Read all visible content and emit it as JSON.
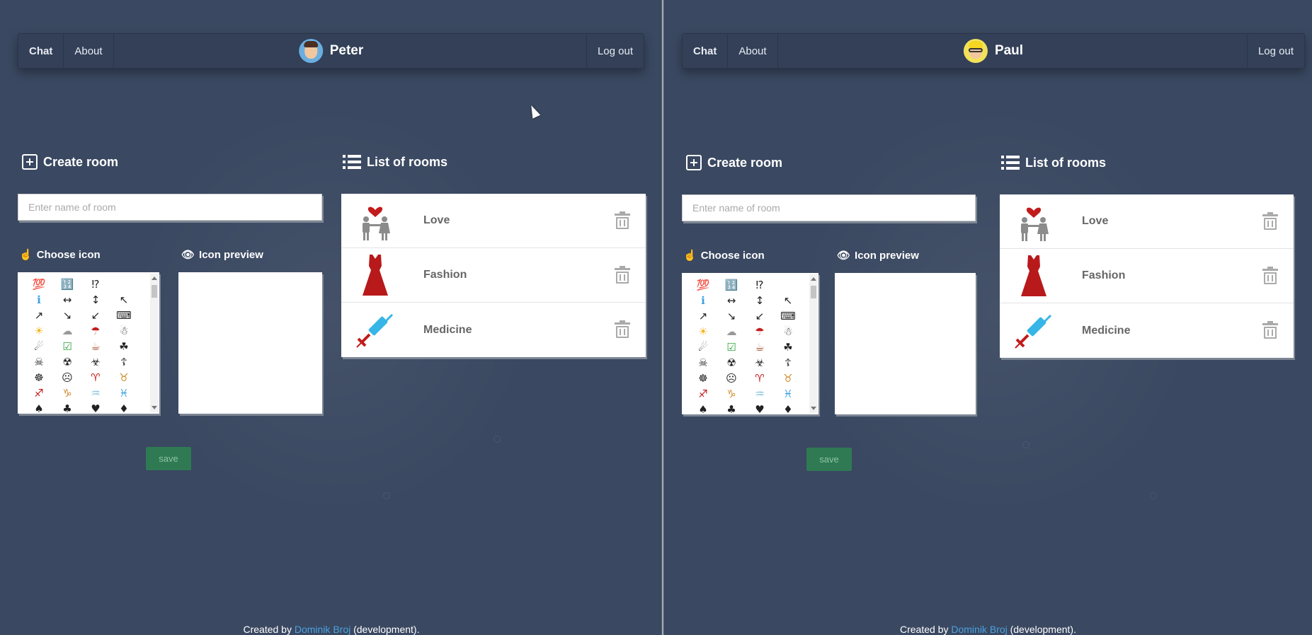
{
  "panes": [
    {
      "nav": {
        "chat": "Chat",
        "about": "About",
        "user": "Peter",
        "logout": "Log out"
      },
      "create_room": {
        "title": "Create room",
        "input_placeholder": "Enter name of room",
        "choose_icon": "Choose icon",
        "icon_preview": "Icon preview",
        "save": "save"
      },
      "list_of_rooms": {
        "title": "List of rooms",
        "rooms": [
          {
            "name": "Love",
            "icon": "couple-heart-icon"
          },
          {
            "name": "Fashion",
            "icon": "dress-icon"
          },
          {
            "name": "Medicine",
            "icon": "syringe-icon"
          }
        ]
      },
      "footer": {
        "prefix": "Created by ",
        "author": "Dominik Broj",
        "suffix": " (development)."
      }
    },
    {
      "nav": {
        "chat": "Chat",
        "about": "About",
        "user": "Paul",
        "logout": "Log out"
      },
      "create_room": {
        "title": "Create room",
        "input_placeholder": "Enter name of room",
        "choose_icon": "Choose icon",
        "icon_preview": "Icon preview",
        "save": "save"
      },
      "list_of_rooms": {
        "title": "List of rooms",
        "rooms": [
          {
            "name": "Love",
            "icon": "couple-heart-icon"
          },
          {
            "name": "Fashion",
            "icon": "dress-icon"
          },
          {
            "name": "Medicine",
            "icon": "syringe-icon"
          }
        ]
      },
      "footer": {
        "prefix": "Created by ",
        "author": "Dominik Broj",
        "suffix": " (development)."
      }
    }
  ],
  "icon_palette": [
    "💯",
    "🔢",
    "⁉",
    "",
    "ℹ",
    "↔",
    "↕",
    "↖",
    "↗",
    "↘",
    "↙",
    "⌨",
    "☀",
    "☁",
    "☂",
    "☃",
    "☄",
    "☑",
    "☕",
    "☘",
    "☠",
    "☢",
    "☣",
    "☦",
    "☸",
    "☹",
    "♈",
    "♉",
    "♐",
    "♑",
    "♒",
    "♓",
    "♠",
    "♣",
    "♥",
    "♦"
  ],
  "colors": {
    "background": "#3a4861",
    "navbar": "#334058",
    "save_button": "#2f7a53",
    "link": "#4aa3e0",
    "room_name": "#666666"
  }
}
